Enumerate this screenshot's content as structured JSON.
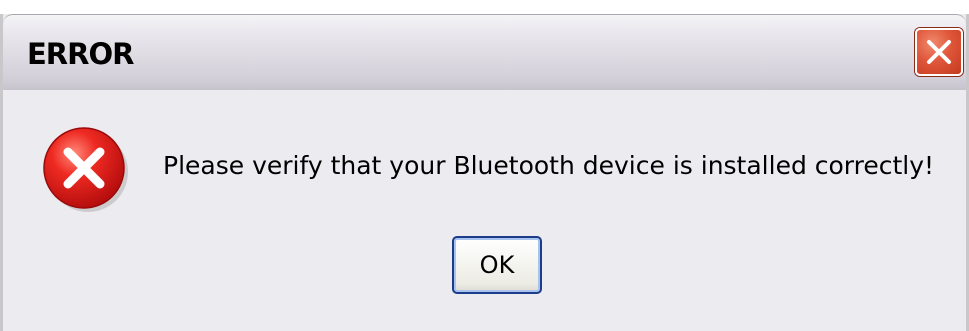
{
  "window": {
    "title": "ERROR",
    "close_icon": "close-icon"
  },
  "dialog": {
    "icon": "error-icon",
    "message": "Please verify that your Bluetooth device is installed correctly!",
    "ok_label": "OK"
  },
  "colors": {
    "close_button": "#e0563a",
    "error_icon_red": "#e02020",
    "ok_border": "#1c3c8a",
    "dialog_bg": "#ecebef"
  }
}
